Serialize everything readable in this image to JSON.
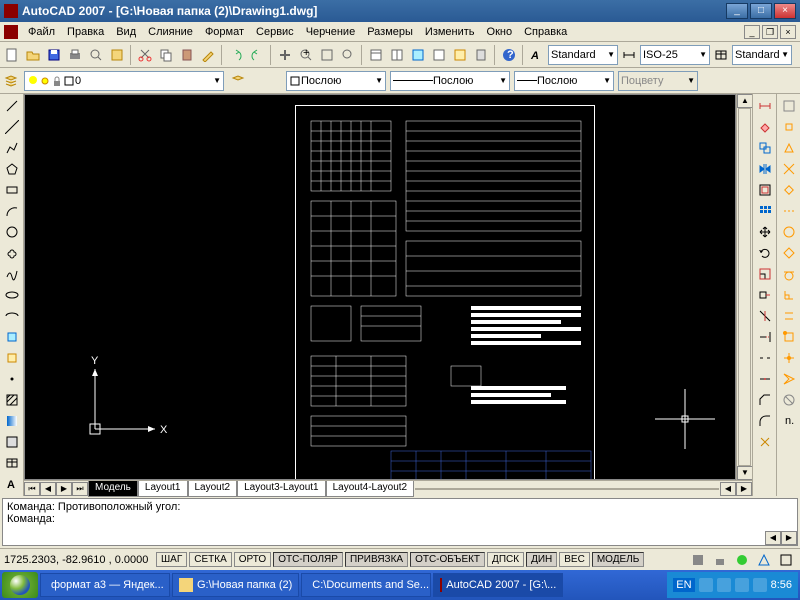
{
  "titlebar": {
    "text": "AutoCAD 2007 - [G:\\Новая папка (2)\\Drawing1.dwg]"
  },
  "menubar": {
    "items": [
      "Файл",
      "Правка",
      "Вид",
      "Слияние",
      "Формат",
      "Сервис",
      "Черчение",
      "Размеры",
      "Изменить",
      "Окно",
      "Справка"
    ]
  },
  "styles": {
    "text_style": "Standard",
    "dim_style": "ISO-25",
    "table_style": "Standard"
  },
  "layers": {
    "current": "0",
    "linetype": "Послою",
    "lineweight": "Послою",
    "plotstyle_label": "Послою",
    "color_disabled": "Поцвету"
  },
  "tabs": {
    "items": [
      "Модель",
      "Layout1",
      "Layout2",
      "Layout3-Layout1",
      "Layout4-Layout2"
    ],
    "active": 0
  },
  "ucs": {
    "x": "X",
    "y": "Y"
  },
  "command": {
    "line1": "Команда: Противоположный угол:",
    "line2": "Команда:"
  },
  "status": {
    "coords": "1725.2303, -82.9610 , 0.0000",
    "buttons": [
      "ШАГ",
      "СЕТКА",
      "ОРТО",
      "ОТС-ПОЛЯР",
      "ПРИВЯЗКА",
      "ОТС-ОБЪЕКТ",
      "ДПСК",
      "ДИН",
      "ВЕС",
      "МОДЕЛЬ"
    ],
    "active_buttons": [
      3,
      4,
      5,
      7,
      9
    ]
  },
  "taskbar": {
    "items": [
      "формат а3 — Яндек...",
      "G:\\Новая папка (2)",
      "C:\\Documents and Se...",
      "AutoCAD 2007 - [G:\\..."
    ],
    "active": 3,
    "lang": "EN",
    "time": "8:56"
  }
}
